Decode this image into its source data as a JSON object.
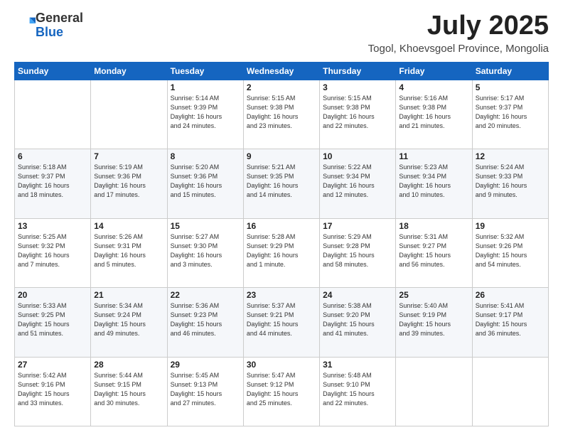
{
  "logo": {
    "line1": "General",
    "line2": "Blue"
  },
  "title": "July 2025",
  "location": "Togol, Khoevsgoel Province, Mongolia",
  "days_of_week": [
    "Sunday",
    "Monday",
    "Tuesday",
    "Wednesday",
    "Thursday",
    "Friday",
    "Saturday"
  ],
  "weeks": [
    [
      {
        "day": "",
        "info": ""
      },
      {
        "day": "",
        "info": ""
      },
      {
        "day": "1",
        "info": "Sunrise: 5:14 AM\nSunset: 9:39 PM\nDaylight: 16 hours\nand 24 minutes."
      },
      {
        "day": "2",
        "info": "Sunrise: 5:15 AM\nSunset: 9:38 PM\nDaylight: 16 hours\nand 23 minutes."
      },
      {
        "day": "3",
        "info": "Sunrise: 5:15 AM\nSunset: 9:38 PM\nDaylight: 16 hours\nand 22 minutes."
      },
      {
        "day": "4",
        "info": "Sunrise: 5:16 AM\nSunset: 9:38 PM\nDaylight: 16 hours\nand 21 minutes."
      },
      {
        "day": "5",
        "info": "Sunrise: 5:17 AM\nSunset: 9:37 PM\nDaylight: 16 hours\nand 20 minutes."
      }
    ],
    [
      {
        "day": "6",
        "info": "Sunrise: 5:18 AM\nSunset: 9:37 PM\nDaylight: 16 hours\nand 18 minutes."
      },
      {
        "day": "7",
        "info": "Sunrise: 5:19 AM\nSunset: 9:36 PM\nDaylight: 16 hours\nand 17 minutes."
      },
      {
        "day": "8",
        "info": "Sunrise: 5:20 AM\nSunset: 9:36 PM\nDaylight: 16 hours\nand 15 minutes."
      },
      {
        "day": "9",
        "info": "Sunrise: 5:21 AM\nSunset: 9:35 PM\nDaylight: 16 hours\nand 14 minutes."
      },
      {
        "day": "10",
        "info": "Sunrise: 5:22 AM\nSunset: 9:34 PM\nDaylight: 16 hours\nand 12 minutes."
      },
      {
        "day": "11",
        "info": "Sunrise: 5:23 AM\nSunset: 9:34 PM\nDaylight: 16 hours\nand 10 minutes."
      },
      {
        "day": "12",
        "info": "Sunrise: 5:24 AM\nSunset: 9:33 PM\nDaylight: 16 hours\nand 9 minutes."
      }
    ],
    [
      {
        "day": "13",
        "info": "Sunrise: 5:25 AM\nSunset: 9:32 PM\nDaylight: 16 hours\nand 7 minutes."
      },
      {
        "day": "14",
        "info": "Sunrise: 5:26 AM\nSunset: 9:31 PM\nDaylight: 16 hours\nand 5 minutes."
      },
      {
        "day": "15",
        "info": "Sunrise: 5:27 AM\nSunset: 9:30 PM\nDaylight: 16 hours\nand 3 minutes."
      },
      {
        "day": "16",
        "info": "Sunrise: 5:28 AM\nSunset: 9:29 PM\nDaylight: 16 hours\nand 1 minute."
      },
      {
        "day": "17",
        "info": "Sunrise: 5:29 AM\nSunset: 9:28 PM\nDaylight: 15 hours\nand 58 minutes."
      },
      {
        "day": "18",
        "info": "Sunrise: 5:31 AM\nSunset: 9:27 PM\nDaylight: 15 hours\nand 56 minutes."
      },
      {
        "day": "19",
        "info": "Sunrise: 5:32 AM\nSunset: 9:26 PM\nDaylight: 15 hours\nand 54 minutes."
      }
    ],
    [
      {
        "day": "20",
        "info": "Sunrise: 5:33 AM\nSunset: 9:25 PM\nDaylight: 15 hours\nand 51 minutes."
      },
      {
        "day": "21",
        "info": "Sunrise: 5:34 AM\nSunset: 9:24 PM\nDaylight: 15 hours\nand 49 minutes."
      },
      {
        "day": "22",
        "info": "Sunrise: 5:36 AM\nSunset: 9:23 PM\nDaylight: 15 hours\nand 46 minutes."
      },
      {
        "day": "23",
        "info": "Sunrise: 5:37 AM\nSunset: 9:21 PM\nDaylight: 15 hours\nand 44 minutes."
      },
      {
        "day": "24",
        "info": "Sunrise: 5:38 AM\nSunset: 9:20 PM\nDaylight: 15 hours\nand 41 minutes."
      },
      {
        "day": "25",
        "info": "Sunrise: 5:40 AM\nSunset: 9:19 PM\nDaylight: 15 hours\nand 39 minutes."
      },
      {
        "day": "26",
        "info": "Sunrise: 5:41 AM\nSunset: 9:17 PM\nDaylight: 15 hours\nand 36 minutes."
      }
    ],
    [
      {
        "day": "27",
        "info": "Sunrise: 5:42 AM\nSunset: 9:16 PM\nDaylight: 15 hours\nand 33 minutes."
      },
      {
        "day": "28",
        "info": "Sunrise: 5:44 AM\nSunset: 9:15 PM\nDaylight: 15 hours\nand 30 minutes."
      },
      {
        "day": "29",
        "info": "Sunrise: 5:45 AM\nSunset: 9:13 PM\nDaylight: 15 hours\nand 27 minutes."
      },
      {
        "day": "30",
        "info": "Sunrise: 5:47 AM\nSunset: 9:12 PM\nDaylight: 15 hours\nand 25 minutes."
      },
      {
        "day": "31",
        "info": "Sunrise: 5:48 AM\nSunset: 9:10 PM\nDaylight: 15 hours\nand 22 minutes."
      },
      {
        "day": "",
        "info": ""
      },
      {
        "day": "",
        "info": ""
      }
    ]
  ]
}
